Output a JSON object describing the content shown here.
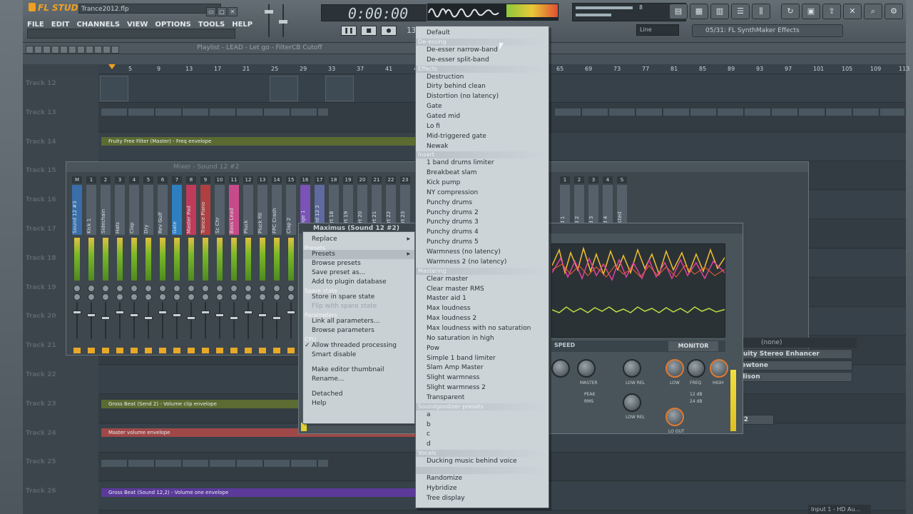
{
  "app": {
    "name": "FL STUDIO",
    "filename": "Trance2012.flp",
    "time": "0:00:00",
    "tempo": "135"
  },
  "menu": [
    "FILE",
    "EDIT",
    "CHANNELS",
    "VIEW",
    "OPTIONS",
    "TOOLS",
    "HELP"
  ],
  "hint_panel": "05/31: FL SynthMaker Effects",
  "playlist_title": "Playlist - LEAD - Let go - FilterCB Cutoff",
  "line_box": "Line",
  "cpu_numbers": [
    "8",
    "130"
  ],
  "ruler": [
    "5",
    "9",
    "13",
    "17",
    "21",
    "25",
    "29",
    "33",
    "37",
    "41",
    "45",
    "49",
    "53",
    "57",
    "61",
    "65",
    "69",
    "73",
    "77",
    "81",
    "85",
    "89",
    "93",
    "97",
    "101",
    "105",
    "109",
    "113"
  ],
  "tracks": [
    "Track 12",
    "Track 13",
    "Track 14",
    "Track 15",
    "Track 16",
    "Track 17",
    "Track 18",
    "Track 19",
    "Track 20",
    "Track 21",
    "Track 22",
    "Track 23",
    "Track 24",
    "Track 25",
    "Track 26"
  ],
  "automation_clips": [
    "Fruity Free Filter (Master) - Freq envelope",
    "Gross Beat (Send 2) - Volume clip envelope",
    "Master volume envelope",
    "Gross Beat (Sound 12,2) - Volume one envelope"
  ],
  "mixer": {
    "title": "Mixer - Sound 12 #2",
    "strips": [
      {
        "num": "M",
        "name": "Sound 12 #3"
      },
      {
        "num": "1",
        "name": "Kick 1"
      },
      {
        "num": "2",
        "name": "Sidechain"
      },
      {
        "num": "3",
        "name": "Hats"
      },
      {
        "num": "4",
        "name": "Clap"
      },
      {
        "num": "5",
        "name": "Dry"
      },
      {
        "num": "6",
        "name": "Rev Gulf"
      },
      {
        "num": "7",
        "name": "Gate"
      },
      {
        "num": "8",
        "name": "Master Pad"
      },
      {
        "num": "9",
        "name": "Trance Piano"
      },
      {
        "num": "10",
        "name": "Sc Chr"
      },
      {
        "num": "11",
        "name": "Bass Lead"
      },
      {
        "num": "12",
        "name": "Pluck"
      },
      {
        "num": "13",
        "name": "Pluck fill"
      },
      {
        "num": "14",
        "name": "FPC Crash"
      },
      {
        "num": "15",
        "name": "Clap 2"
      },
      {
        "num": "16",
        "name": "Orange 1"
      },
      {
        "num": "17",
        "name": "Sound 12 2"
      },
      {
        "num": "18",
        "name": "Insert 18"
      },
      {
        "num": "19",
        "name": "Insert 19"
      },
      {
        "num": "20",
        "name": "Insert 20"
      },
      {
        "num": "21",
        "name": "Insert 21"
      },
      {
        "num": "22",
        "name": "Insert 22"
      },
      {
        "num": "23",
        "name": "Insert 23"
      }
    ],
    "right_strips": [
      {
        "num": "1",
        "name": "Send 1"
      },
      {
        "num": "2",
        "name": "Send 2"
      },
      {
        "num": "3",
        "name": "Send 3"
      },
      {
        "num": "4",
        "name": "Send 4"
      },
      {
        "num": "S",
        "name": "Selected"
      }
    ],
    "fx_none": "(none)",
    "fx_slots": [
      "Fruity Stereo Enhancer",
      "Newtone",
      "Edison"
    ],
    "output": "Input 1 - HD Au...",
    "q2": "Q 2"
  },
  "plugin": {
    "title": "Maximus (Sound 12 #2)",
    "speed": "SPEED",
    "monitor": "MONITOR",
    "knob_labels": [
      "MASTER",
      "LOW REL",
      "LOW",
      "FREQ",
      "HIGH",
      "PEAK",
      "RMS",
      "LOW REL",
      "LO OUT"
    ],
    "db_labels": [
      "12 dB",
      "24 dB"
    ]
  },
  "context_menu": {
    "items": [
      {
        "type": "item",
        "label": "Replace",
        "arrow": true
      },
      {
        "type": "head",
        "label": "Presets"
      },
      {
        "type": "item",
        "label": "Presets",
        "arrow": true,
        "highlight": true
      },
      {
        "type": "item",
        "label": "Browse presets"
      },
      {
        "type": "item",
        "label": "Save preset as..."
      },
      {
        "type": "item",
        "label": "Add to plugin database"
      },
      {
        "type": "head",
        "label": "Spare state"
      },
      {
        "type": "item",
        "label": "Store in spare state"
      },
      {
        "type": "item",
        "label": "Flip with spare state",
        "dim": true
      },
      {
        "type": "head",
        "label": "Parameters"
      },
      {
        "type": "item",
        "label": "Link all parameters..."
      },
      {
        "type": "item",
        "label": "Browse parameters"
      },
      {
        "type": "head",
        "label": "CPU"
      },
      {
        "type": "item",
        "label": "Allow threaded processing",
        "check": true
      },
      {
        "type": "item",
        "label": "Smart disable"
      },
      {
        "type": "head",
        "label": ""
      },
      {
        "type": "item",
        "label": "Make editor thumbnail"
      },
      {
        "type": "item",
        "label": "Rename..."
      },
      {
        "type": "head",
        "label": ""
      },
      {
        "type": "item",
        "label": "Detached"
      },
      {
        "type": "item",
        "label": "Help"
      }
    ]
  },
  "preset_menu": {
    "sections": [
      {
        "head": "",
        "items": [
          "Default"
        ]
      },
      {
        "head": "De-essing",
        "items": [
          "De-esser narrow-band",
          "De-esser split-band"
        ]
      },
      {
        "head": "Effects",
        "items": [
          "Destruction",
          "Dirty behind clean",
          "Distortion (no latency)",
          "Gate",
          "Gated mid",
          "Lo fi",
          "Mid-triggered gate",
          "Newak"
        ]
      },
      {
        "head": "Insert",
        "items": [
          "1 band drums limiter",
          "Breakbeat slam",
          "Kick pump",
          "NY compression",
          "Punchy drums",
          "Punchy drums 2",
          "Punchy drums 3",
          "Punchy drums 4",
          "Punchy drums 5",
          "Warmness (no latency)",
          "Warmness 2 (no latency)"
        ]
      },
      {
        "head": "Mastering",
        "items": [
          "Clear master",
          "Clear master RMS",
          "Master aid 1",
          "Max loudness",
          "Max loudness 2",
          "Max loudness with no saturation",
          "No saturation in high",
          "Pow",
          "Simple 1 band limiter",
          "Slam Amp Master",
          "Slight warmness",
          "Slight warmness 2",
          "Transparent"
        ]
      },
      {
        "head": "Soundgoodizer presets",
        "items": [
          "a",
          "b",
          "c",
          "d"
        ]
      },
      {
        "head": "Vocals",
        "items": [
          "Ducking music behind voice"
        ]
      },
      {
        "head": "",
        "items": [
          "Randomize",
          "Hybridize",
          "Tree display"
        ]
      }
    ]
  }
}
